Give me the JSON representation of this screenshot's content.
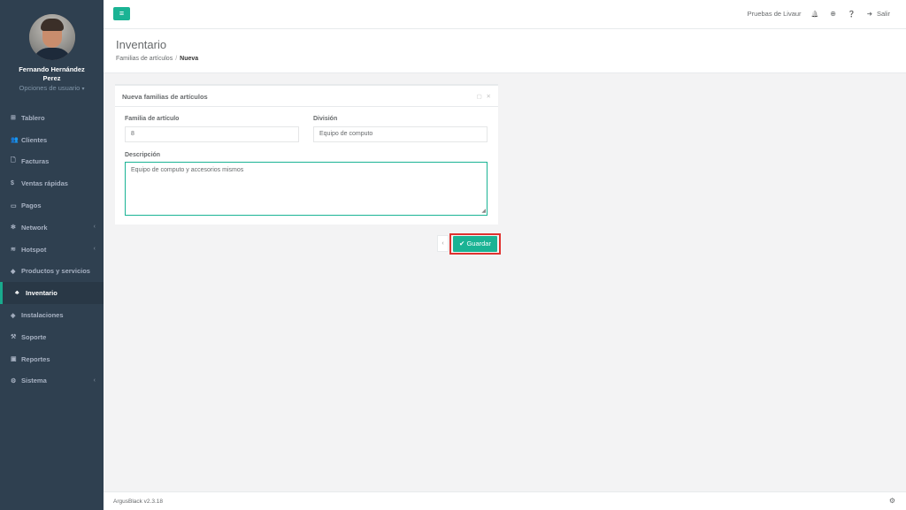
{
  "user": {
    "name": "Fernando Hernández Perez",
    "options_label": "Opciones de usuario",
    "options_caret": "▾"
  },
  "sidebar": {
    "items": [
      {
        "label": "Tablero",
        "icon": "dashboard-icon",
        "glyph": "⊞",
        "chevron": ""
      },
      {
        "label": "Clientes",
        "icon": "users-icon",
        "glyph": "👥",
        "chevron": ""
      },
      {
        "label": "Facturas",
        "icon": "file-icon",
        "glyph": "🗋",
        "chevron": ""
      },
      {
        "label": "Ventas rápidas",
        "icon": "dollar-icon",
        "glyph": "$",
        "chevron": ""
      },
      {
        "label": "Pagos",
        "icon": "money-icon",
        "glyph": "▭",
        "chevron": ""
      },
      {
        "label": "Network",
        "icon": "snowflake-icon",
        "glyph": "✻",
        "chevron": "‹"
      },
      {
        "label": "Hotspot",
        "icon": "wifi-icon",
        "glyph": "≋",
        "chevron": "‹"
      },
      {
        "label": "Productos y servicios",
        "icon": "tags-icon",
        "glyph": "◆",
        "chevron": ""
      },
      {
        "label": "Inventario",
        "icon": "cubes-icon",
        "glyph": "♣",
        "chevron": ""
      },
      {
        "label": "Instalaciones",
        "icon": "tag-icon",
        "glyph": "◈",
        "chevron": ""
      },
      {
        "label": "Soporte",
        "icon": "wrench-icon",
        "glyph": "⚒",
        "chevron": ""
      },
      {
        "label": "Reportes",
        "icon": "book-icon",
        "glyph": "▣",
        "chevron": ""
      },
      {
        "label": "Sistema",
        "icon": "cogs-icon",
        "glyph": "⚙",
        "chevron": "‹"
      }
    ]
  },
  "topbar": {
    "menu_glyph": "≡",
    "user_label": "Pruebas de Livaur",
    "bell_glyph": "🔔",
    "globe_glyph": "⊕",
    "help_glyph": "❓",
    "logout_glyph": "➜",
    "logout_label": "Salir"
  },
  "heading": {
    "title": "Inventario",
    "breadcrumb_parent": "Familias de artículos",
    "breadcrumb_sep": "/",
    "breadcrumb_current": "Nueva"
  },
  "form": {
    "panel_title": "Nueva familias de artículos",
    "save_tool_glyph": "▢",
    "close_tool_glyph": "✕",
    "family_label": "Familia de artículo",
    "family_value": "8",
    "division_label": "División",
    "division_value": "Equipo de computo",
    "description_label": "Descripción",
    "description_value": "Equipo de computo y accesorios mismos",
    "resize_glyph": "◢"
  },
  "actions": {
    "back_glyph": "‹",
    "save_check": "✔",
    "save_label": "Guardar"
  },
  "footer": {
    "version": "ArgusBlack v2.3.18",
    "icon_glyph": "⚙"
  },
  "colors": {
    "sidebar_bg": "#2f4050",
    "accent": "#1ab394",
    "highlight_border": "#e0312f"
  }
}
